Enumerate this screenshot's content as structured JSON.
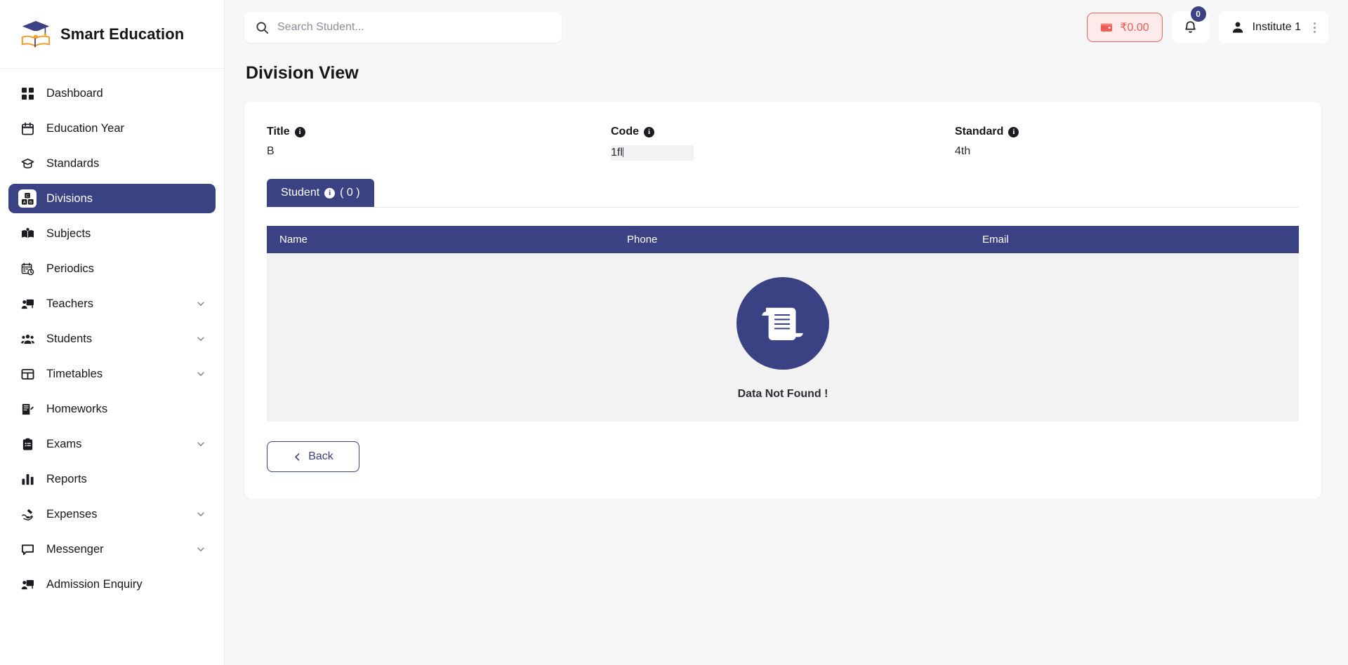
{
  "brand": {
    "name": "Smart Education",
    "logo_icon": "graduation-cap-book-logo"
  },
  "sidebar": {
    "items": [
      {
        "label": "Dashboard",
        "icon": "grid-icon",
        "expandable": false,
        "active": false
      },
      {
        "label": "Education Year",
        "icon": "calendar-icon",
        "expandable": false,
        "active": false
      },
      {
        "label": "Standards",
        "icon": "graduation-cap-icon",
        "expandable": false,
        "active": false
      },
      {
        "label": "Divisions",
        "icon": "blocks-abc-icon",
        "expandable": false,
        "active": true
      },
      {
        "label": "Subjects",
        "icon": "open-book-icon",
        "expandable": false,
        "active": false
      },
      {
        "label": "Periodics",
        "icon": "calendar-clock-icon",
        "expandable": false,
        "active": false
      },
      {
        "label": "Teachers",
        "icon": "teacher-board-icon",
        "expandable": true,
        "active": false
      },
      {
        "label": "Students",
        "icon": "users-group-icon",
        "expandable": true,
        "active": false
      },
      {
        "label": "Timetables",
        "icon": "table-icon",
        "expandable": true,
        "active": false
      },
      {
        "label": "Homeworks",
        "icon": "document-pen-icon",
        "expandable": false,
        "active": false
      },
      {
        "label": "Exams",
        "icon": "clipboard-list-icon",
        "expandable": true,
        "active": false
      },
      {
        "label": "Reports",
        "icon": "bar-chart-icon",
        "expandable": false,
        "active": false
      },
      {
        "label": "Expenses",
        "icon": "hand-money-icon",
        "expandable": true,
        "active": false
      },
      {
        "label": "Messenger",
        "icon": "chat-bubble-icon",
        "expandable": true,
        "active": false
      },
      {
        "label": "Admission Enquiry",
        "icon": "person-board-icon",
        "expandable": false,
        "active": false
      }
    ]
  },
  "topbar": {
    "search_placeholder": "Search Student...",
    "search_value": "",
    "search_icon": "search-icon",
    "wallet": {
      "icon": "wallet-icon",
      "amount": "₹0.00",
      "color": "#ef5a55",
      "bg": "#fdeaea"
    },
    "notifications": {
      "icon": "bell-icon",
      "count": "0",
      "badge_color": "#3b4284"
    },
    "user": {
      "icon": "user-avatar-icon",
      "name": "Institute 1",
      "menu_icon": "kebab-menu-icon"
    }
  },
  "page": {
    "title": "Division View",
    "details": [
      {
        "label": "Title",
        "value": "B",
        "info_icon": "info-icon",
        "highlighted": false
      },
      {
        "label": "Code",
        "value": "1fl",
        "info_icon": "info-icon",
        "highlighted": true
      },
      {
        "label": "Standard",
        "value": "4th",
        "info_icon": "info-icon",
        "highlighted": false
      }
    ],
    "tab": {
      "label": "Student",
      "info_icon": "info-icon",
      "count": "( 0 )",
      "active": true
    },
    "table": {
      "columns": [
        "Name",
        "Phone",
        "Email"
      ],
      "rows": [],
      "empty_state": {
        "icon": "scroll-document-icon",
        "text": "Data Not Found !",
        "circle_color": "#3b4284"
      }
    },
    "back_button": {
      "label": "Back",
      "icon": "chevron-left-icon"
    }
  },
  "theme": {
    "accent": "#3b4284",
    "page_bg": "#f7f7f8",
    "card_bg": "#ffffff",
    "danger": "#ef5a55"
  }
}
